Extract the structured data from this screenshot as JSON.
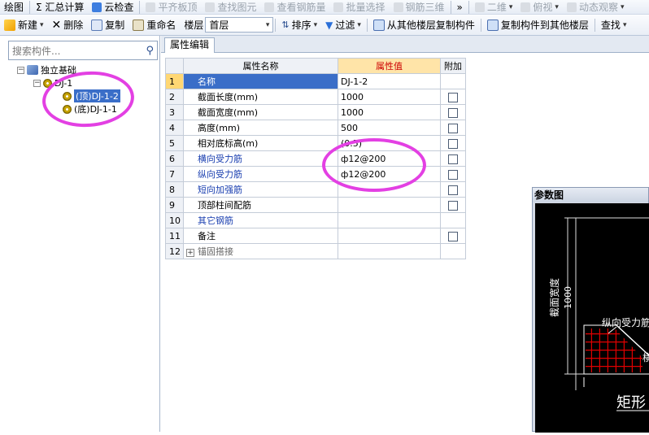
{
  "toolbar1": {
    "items": [
      {
        "label": "绘图",
        "disabled": false
      },
      {
        "label": "Σ 汇总计算",
        "disabled": false
      },
      {
        "label": "云检查",
        "disabled": false
      },
      {
        "label": "平齐板顶",
        "disabled": true
      },
      {
        "label": "查找图元",
        "disabled": true
      },
      {
        "label": "查看钢筋量",
        "disabled": true
      },
      {
        "label": "批量选择",
        "disabled": true
      },
      {
        "label": "钢筋三维",
        "disabled": true
      },
      {
        "label": "»",
        "disabled": false
      },
      {
        "label": "二维",
        "disabled": true
      },
      {
        "label": "俯视",
        "disabled": true
      },
      {
        "label": "动态观察",
        "disabled": true
      }
    ]
  },
  "toolbar2": {
    "new_label": "新建",
    "delete_label": "删除",
    "copy_label": "复制",
    "rename_label": "重命名",
    "floor_label": "楼层",
    "floor_value": "首层",
    "sort_label": "排序",
    "filter_label": "过滤",
    "copy_from_label": "从其他楼层复制构件",
    "copy_to_label": "复制构件到其他楼层",
    "find_label": "查找"
  },
  "left": {
    "search_placeholder": "搜索构件...",
    "tree": {
      "root": "独立基础",
      "child": "DJ-1",
      "leaf_top": "(顶)DJ-1-2",
      "leaf_bottom": "(底)DJ-1-1"
    }
  },
  "right": {
    "tab_label": "属性编辑",
    "table": {
      "headers": {
        "name": "属性名称",
        "value": "属性值",
        "extra": "附加"
      },
      "rows": [
        {
          "no": "1",
          "name": "名称",
          "value": "DJ-1-2",
          "blue": false,
          "check": false,
          "selected": true,
          "expand": false
        },
        {
          "no": "2",
          "name": "截面长度(mm)",
          "value": "1000",
          "blue": false,
          "check": true,
          "selected": false,
          "expand": false
        },
        {
          "no": "3",
          "name": "截面宽度(mm)",
          "value": "1000",
          "blue": false,
          "check": true,
          "selected": false,
          "expand": false
        },
        {
          "no": "4",
          "name": "高度(mm)",
          "value": "500",
          "blue": false,
          "check": true,
          "selected": false,
          "expand": false
        },
        {
          "no": "5",
          "name": "相对底标高(m)",
          "value": "(0.5)",
          "blue": false,
          "check": true,
          "selected": false,
          "expand": false
        },
        {
          "no": "6",
          "name": "横向受力筋",
          "value": "ф12@200",
          "blue": true,
          "check": true,
          "selected": false,
          "expand": false
        },
        {
          "no": "7",
          "name": "纵向受力筋",
          "value": "ф12@200",
          "blue": true,
          "check": true,
          "selected": false,
          "expand": false
        },
        {
          "no": "8",
          "name": "短向加强筋",
          "value": "",
          "blue": true,
          "check": true,
          "selected": false,
          "expand": false
        },
        {
          "no": "9",
          "name": "顶部柱间配筋",
          "value": "",
          "blue": false,
          "check": true,
          "selected": false,
          "expand": false
        },
        {
          "no": "10",
          "name": "其它钢筋",
          "value": "",
          "blue": true,
          "check": false,
          "selected": false,
          "expand": false
        },
        {
          "no": "11",
          "name": "备注",
          "value": "",
          "blue": false,
          "check": true,
          "selected": false,
          "expand": false
        },
        {
          "no": "12",
          "name": "锚固搭接",
          "value": "",
          "blue": false,
          "check": false,
          "selected": false,
          "expand": true
        }
      ]
    }
  },
  "param": {
    "title": "参数图",
    "dim_width_label": "截面宽度",
    "dim_width_value": "1000",
    "rebar_label": "纵向受力筋",
    "partial_label": "横",
    "caption": "矩形"
  },
  "colors": {
    "annotation": "#e340e3",
    "rebar": "#e00000",
    "selection": "#3a6ec8"
  }
}
